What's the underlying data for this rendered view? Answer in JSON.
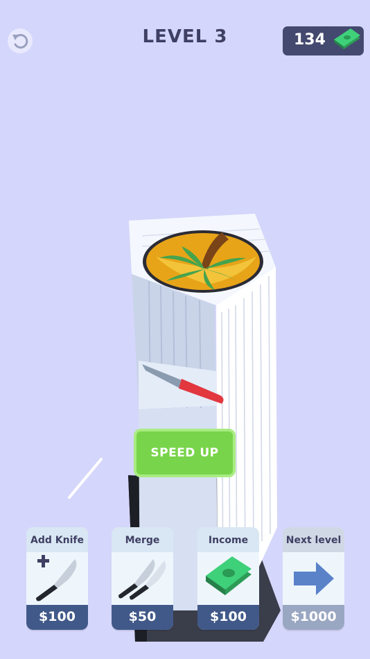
{
  "header": {
    "level_title": "LEVEL 3",
    "money": "134",
    "restart_icon": "restart-icon",
    "money_icon": "cash-stack-icon"
  },
  "game": {
    "speed_up_label": "SPEED UP"
  },
  "shop": {
    "items": [
      {
        "label": "Add Knife",
        "price": "$100",
        "icon": "add-knife-icon"
      },
      {
        "label": "Merge",
        "price": "$50",
        "icon": "merge-knives-icon"
      },
      {
        "label": "Income",
        "price": "$100",
        "icon": "cash-stack-icon"
      },
      {
        "label": "Next level",
        "price": "$1000",
        "icon": "arrow-right-icon"
      }
    ]
  },
  "colors": {
    "background": "#d5d6fb",
    "speed_up": "#78d44a",
    "price_bar": "#415989",
    "knife_handle": "#e2373f",
    "cash": "#3fd07a"
  }
}
